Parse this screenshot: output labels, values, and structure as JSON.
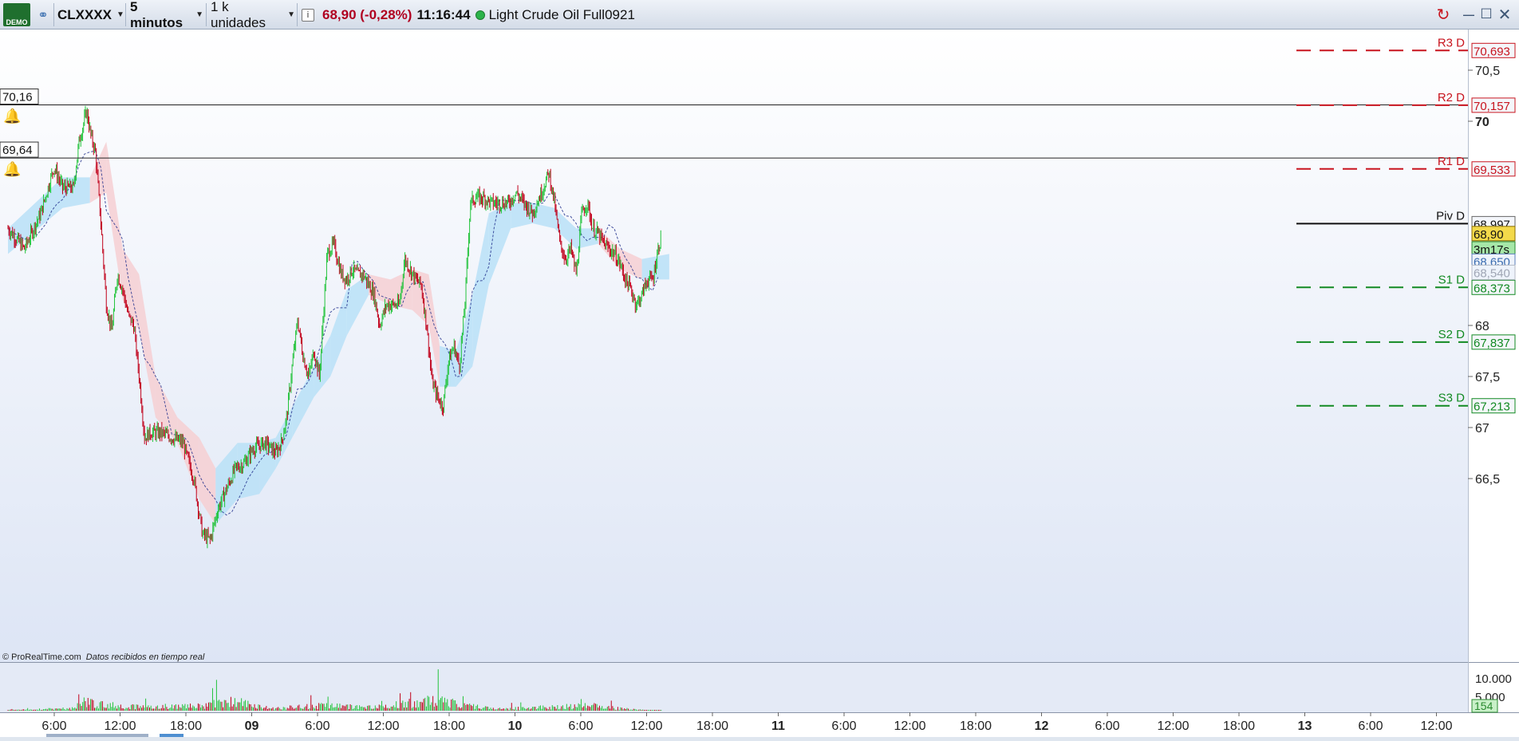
{
  "toolbar": {
    "demo_badge": "DEMO",
    "link_icon": "link-icon",
    "symbol": "CLXXXX",
    "timeframe": "5 minutos",
    "units": "1 k unidades",
    "info_icon": "i",
    "price_change": "68,90 (-0,28%)",
    "time": "11:16:44",
    "instrument": "Light Crude Oil Full0921",
    "window_buttons": {
      "refresh": "↻",
      "minimize": "—",
      "maximize": "☐",
      "close": "✕"
    }
  },
  "colors": {
    "up_candle": "#22c33b",
    "down_candle": "#c0001a",
    "pivot_red": "#c8141e",
    "pivot_green": "#128a22",
    "cloud_blue": "#b9e0f7",
    "cloud_red": "#f6cfd2"
  },
  "alerts": [
    {
      "label": "70,16",
      "value": 70.16
    },
    {
      "label": "69,64",
      "value": 69.64
    }
  ],
  "pivots": [
    {
      "name": "R3 D",
      "price": "70,693",
      "value": 70.693,
      "kind": "res"
    },
    {
      "name": "R2 D",
      "price": "70,157",
      "value": 70.157,
      "kind": "res"
    },
    {
      "name": "R1 D",
      "price": "69,533",
      "value": 69.533,
      "kind": "res"
    },
    {
      "name": "Piv D",
      "price": "68,997",
      "value": 68.997,
      "kind": "piv"
    },
    {
      "name": "S1 D",
      "price": "68,373",
      "value": 68.373,
      "kind": "sup"
    },
    {
      "name": "S2 D",
      "price": "67,837",
      "value": 67.837,
      "kind": "sup"
    },
    {
      "name": "S3 D",
      "price": "67,213",
      "value": 67.213,
      "kind": "sup"
    }
  ],
  "right_labels": {
    "last_price": "68,90",
    "countdown": "3m17s",
    "tenkan": "68,650",
    "kijun": "68,540"
  },
  "price_axis": [
    {
      "label": "70,5",
      "value": 70.5,
      "bold": false
    },
    {
      "label": "70",
      "value": 70.0,
      "bold": true
    },
    {
      "label": "68",
      "value": 68.0,
      "bold": false
    },
    {
      "label": "67,5",
      "value": 67.5,
      "bold": false
    },
    {
      "label": "67",
      "value": 67.0,
      "bold": false
    },
    {
      "label": "66,5",
      "value": 66.5,
      "bold": false
    }
  ],
  "volume_axis": {
    "top": "10.000",
    "mid": "5.000",
    "current": "154"
  },
  "time_axis": [
    {
      "label": "6:00",
      "bold": false
    },
    {
      "label": "12:00",
      "bold": false
    },
    {
      "label": "18:00",
      "bold": false
    },
    {
      "label": "09",
      "bold": true
    },
    {
      "label": "6:00",
      "bold": false
    },
    {
      "label": "12:00",
      "bold": false
    },
    {
      "label": "18:00",
      "bold": false
    },
    {
      "label": "10",
      "bold": true
    },
    {
      "label": "6:00",
      "bold": false
    },
    {
      "label": "12:00",
      "bold": false
    },
    {
      "label": "18:00",
      "bold": false
    },
    {
      "label": "11",
      "bold": true
    },
    {
      "label": "6:00",
      "bold": false
    },
    {
      "label": "12:00",
      "bold": false
    },
    {
      "label": "18:00",
      "bold": false
    },
    {
      "label": "12",
      "bold": true
    },
    {
      "label": "6:00",
      "bold": false
    },
    {
      "label": "12:00",
      "bold": false
    },
    {
      "label": "18:00",
      "bold": false
    },
    {
      "label": "13",
      "bold": true
    },
    {
      "label": "6:00",
      "bold": false
    },
    {
      "label": "12:00",
      "bold": false
    }
  ],
  "footer": {
    "copyright": "© ProRealTime.com",
    "realtime": "Datos recibidos en tiempo real"
  },
  "chart_data": {
    "type": "line",
    "ylim": [
      65.95,
      70.9
    ],
    "price_path": [
      [
        0,
        68.95
      ],
      [
        1.5,
        68.75
      ],
      [
        3,
        69.1
      ],
      [
        4.2,
        69.55
      ],
      [
        5,
        69.35
      ],
      [
        6,
        69.35
      ],
      [
        6.5,
        69.8
      ],
      [
        7.2,
        70.1
      ],
      [
        7.6,
        69.85
      ],
      [
        8,
        69.7
      ],
      [
        8.5,
        69.0
      ],
      [
        9,
        68.2
      ],
      [
        9.5,
        67.95
      ],
      [
        10,
        68.5
      ],
      [
        10.5,
        68.35
      ],
      [
        11,
        68.1
      ],
      [
        11.5,
        68.0
      ],
      [
        12,
        67.5
      ],
      [
        12.5,
        66.9
      ],
      [
        13,
        66.95
      ],
      [
        14,
        66.95
      ],
      [
        15,
        66.9
      ],
      [
        16,
        66.85
      ],
      [
        17,
        66.5
      ],
      [
        17.8,
        65.95
      ],
      [
        18.5,
        65.9
      ],
      [
        19.2,
        66.2
      ],
      [
        20,
        66.4
      ],
      [
        20.8,
        66.6
      ],
      [
        21.6,
        66.65
      ],
      [
        22.5,
        66.8
      ],
      [
        23.5,
        66.85
      ],
      [
        24.5,
        66.75
      ],
      [
        25,
        66.85
      ],
      [
        25.5,
        67.1
      ],
      [
        26,
        67.6
      ],
      [
        26.5,
        68.05
      ],
      [
        27,
        67.7
      ],
      [
        27.5,
        67.5
      ],
      [
        28,
        67.75
      ],
      [
        28.5,
        67.5
      ],
      [
        29.2,
        68.7
      ],
      [
        29.8,
        68.8
      ],
      [
        30.5,
        68.5
      ],
      [
        31,
        68.45
      ],
      [
        31.5,
        68.55
      ],
      [
        32,
        68.5
      ],
      [
        32.5,
        68.5
      ],
      [
        33,
        68.4
      ],
      [
        33.5,
        68.3
      ],
      [
        34,
        68.0
      ],
      [
        34.6,
        68.2
      ],
      [
        35.2,
        68.2
      ],
      [
        35.8,
        68.2
      ],
      [
        36.3,
        68.65
      ],
      [
        36.8,
        68.55
      ],
      [
        37.3,
        68.45
      ],
      [
        37.8,
        68.4
      ],
      [
        38.3,
        68.0
      ],
      [
        38.8,
        67.45
      ],
      [
        39.3,
        67.3
      ],
      [
        39.8,
        67.2
      ],
      [
        40.3,
        67.65
      ],
      [
        40.8,
        67.8
      ],
      [
        41.3,
        67.6
      ],
      [
        41.8,
        68.2
      ],
      [
        42.3,
        69.2
      ],
      [
        42.8,
        69.25
      ],
      [
        43.5,
        69.25
      ],
      [
        44.2,
        69.2
      ],
      [
        45,
        69.2
      ],
      [
        45.8,
        69.2
      ],
      [
        46.5,
        69.3
      ],
      [
        47.2,
        69.2
      ],
      [
        48,
        69.1
      ],
      [
        48.8,
        69.3
      ],
      [
        49.5,
        69.5
      ],
      [
        50,
        69.2
      ],
      [
        50.5,
        68.8
      ],
      [
        51,
        68.65
      ],
      [
        51.5,
        68.75
      ],
      [
        52,
        68.5
      ],
      [
        52.5,
        69.1
      ],
      [
        53,
        69.2
      ],
      [
        53.5,
        68.95
      ],
      [
        54,
        68.9
      ],
      [
        54.5,
        68.8
      ],
      [
        55,
        68.75
      ],
      [
        55.5,
        68.7
      ],
      [
        56,
        68.6
      ],
      [
        56.5,
        68.45
      ],
      [
        57,
        68.35
      ],
      [
        57.5,
        68.2
      ],
      [
        58,
        68.3
      ],
      [
        58.5,
        68.45
      ],
      [
        59,
        68.45
      ],
      [
        59.4,
        68.7
      ],
      [
        59.8,
        68.9
      ]
    ],
    "cloud": [
      [
        0,
        68.95,
        68.7,
        "blue"
      ],
      [
        5,
        69.45,
        69.15,
        "blue"
      ],
      [
        7.5,
        69.45,
        69.2,
        "red"
      ],
      [
        9,
        69.8,
        69.3,
        "red"
      ],
      [
        10.5,
        68.75,
        68.25,
        "red"
      ],
      [
        12,
        68.5,
        67.95,
        "red"
      ],
      [
        13.5,
        67.5,
        67.1,
        "red"
      ],
      [
        15.5,
        67.1,
        66.85,
        "red"
      ],
      [
        17.5,
        66.9,
        66.3,
        "red"
      ],
      [
        19,
        66.6,
        66.05,
        "blue"
      ],
      [
        21,
        66.85,
        66.3,
        "blue"
      ],
      [
        23,
        66.85,
        66.35,
        "blue"
      ],
      [
        24.5,
        66.9,
        66.6,
        "blue"
      ],
      [
        26,
        67.2,
        66.9,
        "blue"
      ],
      [
        28,
        67.6,
        67.3,
        "blue"
      ],
      [
        29.5,
        67.9,
        67.5,
        "blue"
      ],
      [
        31,
        68.35,
        67.9,
        "blue"
      ],
      [
        33,
        68.5,
        68.3,
        "red"
      ],
      [
        35,
        68.45,
        68.2,
        "red"
      ],
      [
        37,
        68.55,
        68.15,
        "red"
      ],
      [
        38.5,
        68.5,
        68.0,
        "red"
      ],
      [
        39.5,
        67.8,
        67.4,
        "blue"
      ],
      [
        41,
        67.75,
        67.4,
        "blue"
      ],
      [
        42.5,
        68.3,
        67.6,
        "blue"
      ],
      [
        44,
        69.1,
        68.4,
        "blue"
      ],
      [
        46,
        69.2,
        68.95,
        "blue"
      ],
      [
        48,
        69.2,
        69.0,
        "blue"
      ],
      [
        50,
        69.15,
        68.95,
        "blue"
      ],
      [
        52,
        68.95,
        68.75,
        "blue"
      ],
      [
        54,
        68.95,
        68.8,
        "red"
      ],
      [
        56,
        68.75,
        68.55,
        "red"
      ],
      [
        58,
        68.65,
        68.45,
        "blue"
      ],
      [
        60.5,
        68.7,
        68.45,
        "blue"
      ]
    ],
    "volume_profile": [
      [
        0,
        600
      ],
      [
        6,
        2200
      ],
      [
        7,
        9000
      ],
      [
        8.5,
        5500
      ],
      [
        12,
        3800
      ],
      [
        18,
        4200
      ],
      [
        20,
        9800
      ],
      [
        24,
        2000
      ],
      [
        29.5,
        5000
      ],
      [
        33,
        3000
      ],
      [
        39.5,
        9500
      ],
      [
        41,
        6000
      ],
      [
        45,
        1800
      ],
      [
        50,
        3500
      ],
      [
        53.5,
        4500
      ],
      [
        57,
        1200
      ],
      [
        60,
        154
      ]
    ]
  }
}
